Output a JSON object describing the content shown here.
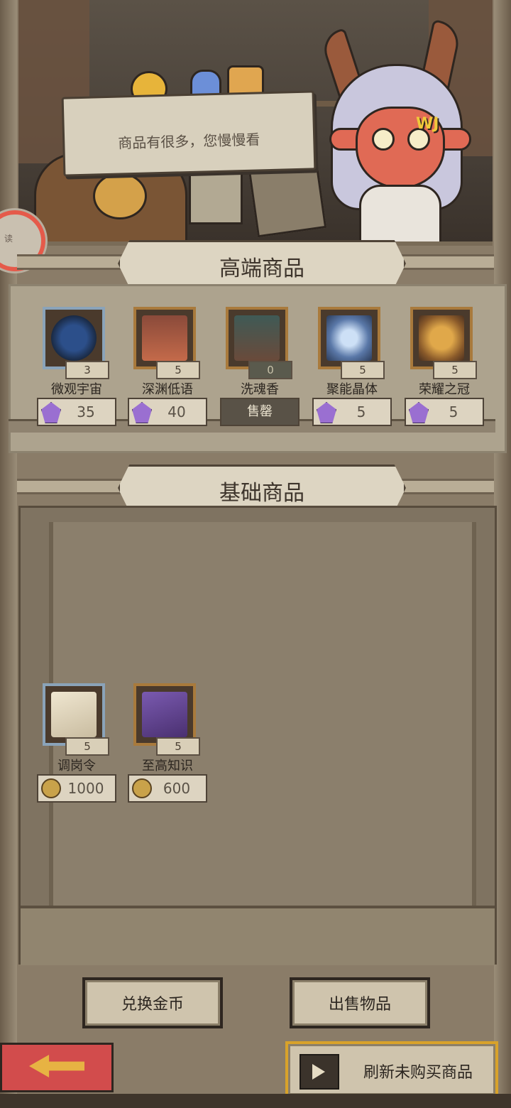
{
  "scene": {
    "speech_text": "商品有很多，您慢慢看",
    "character_clip": "WJ",
    "side_badge": "读"
  },
  "sections": {
    "premium_title": "高端商品",
    "basic_title": "基础商品"
  },
  "premium_items": [
    {
      "name": "微观宇宙",
      "count": "3",
      "price": "35",
      "currency": "crystal-icon",
      "frame": "blue"
    },
    {
      "name": "深渊低语",
      "count": "5",
      "price": "40",
      "currency": "crystal-icon",
      "frame": "gold"
    },
    {
      "name": "洗魂香",
      "count": "0",
      "price": "售罄",
      "currency": "",
      "frame": "gold",
      "sold_out": true
    },
    {
      "name": "聚能晶体",
      "count": "5",
      "price": "5",
      "currency": "crystal-icon",
      "frame": "gold"
    },
    {
      "name": "荣耀之冠",
      "count": "5",
      "price": "5",
      "currency": "crystal-icon",
      "frame": "gold"
    }
  ],
  "basic_items": [
    {
      "name": "调岗令",
      "count": "5",
      "price": "1000",
      "currency": "coin-icon",
      "frame": "blue"
    },
    {
      "name": "至高知识",
      "count": "5",
      "price": "600",
      "currency": "coin-icon",
      "frame": "gold"
    }
  ],
  "buttons": {
    "exchange_gold": "兑换金币",
    "sell_items": "出售物品",
    "refresh": "刷新未购买商品",
    "back_icon": "back-arrow-icon",
    "refresh_icon": "video-ad-icon"
  },
  "colors": {
    "crystal": "#9a6fd1",
    "coin": "#c9a24a",
    "back_button": "#d24c4c",
    "refresh_border": "#d8a22a"
  }
}
